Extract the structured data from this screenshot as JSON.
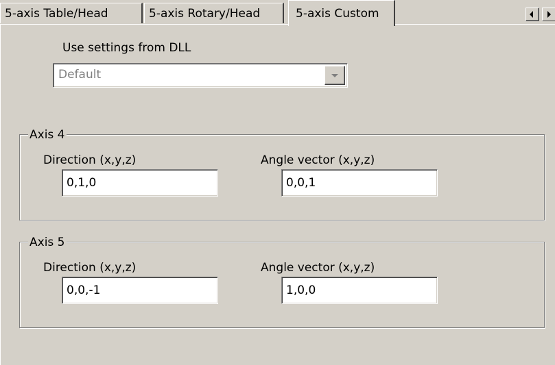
{
  "tabs": [
    {
      "label": "5-axis Table/Head",
      "selected": false
    },
    {
      "label": "5-axis Rotary/Head",
      "selected": false
    },
    {
      "label": "5-axis Custom",
      "selected": true
    }
  ],
  "tab_scroll": {
    "left_icon": "arrow-left-icon",
    "right_icon": "arrow-right-icon"
  },
  "dll": {
    "label": "Use settings from DLL",
    "value": "Default",
    "disabled": true
  },
  "axis4": {
    "title": "Axis 4",
    "direction_label": "Direction (x,y,z)",
    "direction_value": "0,1,0",
    "angle_label": "Angle vector (x,y,z)",
    "angle_value": "0,0,1"
  },
  "axis5": {
    "title": "Axis 5",
    "direction_label": "Direction (x,y,z)",
    "direction_value": "0,0,-1",
    "angle_label": "Angle vector (x,y,z)",
    "angle_value": "1,0,0"
  },
  "colors": {
    "dialog_background": "#d4d0c8",
    "disabled_text": "#808080",
    "field_background": "#ffffff"
  }
}
